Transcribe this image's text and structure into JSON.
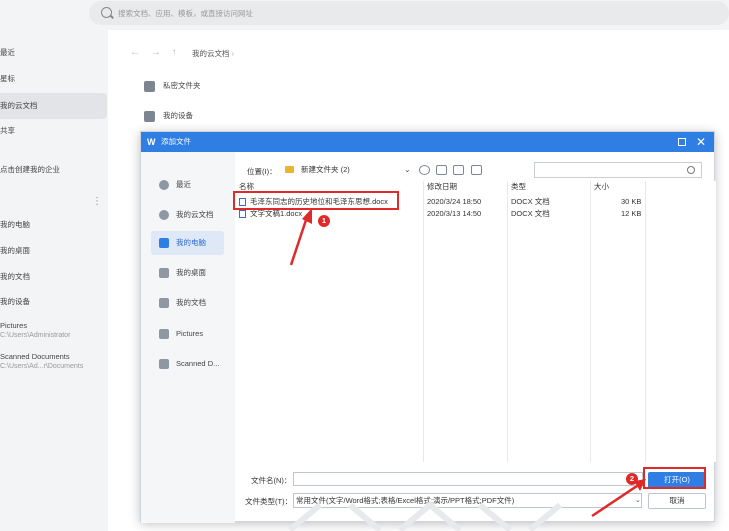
{
  "search": {
    "placeholder": "搜索文档、应用、模板，或直接访问网址"
  },
  "sidebar": {
    "items": [
      {
        "label": "最近"
      },
      {
        "label": "星标"
      },
      {
        "label": "我的云文档"
      },
      {
        "label": "共享"
      },
      {
        "label": "点击创建我的企业"
      },
      {
        "label": "我的电脑"
      },
      {
        "label": "我的桌面"
      },
      {
        "label": "我的文档"
      },
      {
        "label": "我的设备"
      },
      {
        "label": "Pictures",
        "sub": "C:\\Users\\Administrator"
      },
      {
        "label": "Scanned Documents",
        "sub": "C:\\Users\\Ad...r\\Documents"
      }
    ],
    "more": "⋮"
  },
  "main": {
    "breadcrumb": "我的云文档",
    "rows": [
      {
        "label": "私密文件夹"
      },
      {
        "label": "我的设备"
      }
    ]
  },
  "dialog": {
    "title": "添加文件",
    "places": [
      {
        "label": "最近"
      },
      {
        "label": "我的云文档"
      },
      {
        "label": "我的电脑"
      },
      {
        "label": "我的桌面"
      },
      {
        "label": "我的文档"
      },
      {
        "label": "Pictures"
      },
      {
        "label": "Scanned D..."
      }
    ],
    "location_label": "位置(I)：",
    "location_value": "新建文件夹 (2)",
    "columns": {
      "name": "名称",
      "date": "修改日期",
      "type": "类型",
      "size": "大小"
    },
    "files": [
      {
        "name": "毛泽东同志的历史地位和毛泽东思想.docx",
        "date": "2020/3/24 18:50",
        "type": "DOCX 文档",
        "size": "30 KB"
      },
      {
        "name": "文字文稿1.docx",
        "date": "2020/3/13 14:50",
        "type": "DOCX 文档",
        "size": "12 KB"
      }
    ],
    "filename_label": "文件名(N)：",
    "filename_value": "",
    "filetype_label": "文件类型(T)：",
    "filetype_value": "常用文件(文字/Word格式;表格/Excel格式;演示/PPT格式;PDF文件)",
    "open_label": "打开(O)",
    "cancel_label": "取消"
  },
  "annotations": {
    "step1": "1",
    "step2": "2",
    "color": "#e02a2a"
  }
}
